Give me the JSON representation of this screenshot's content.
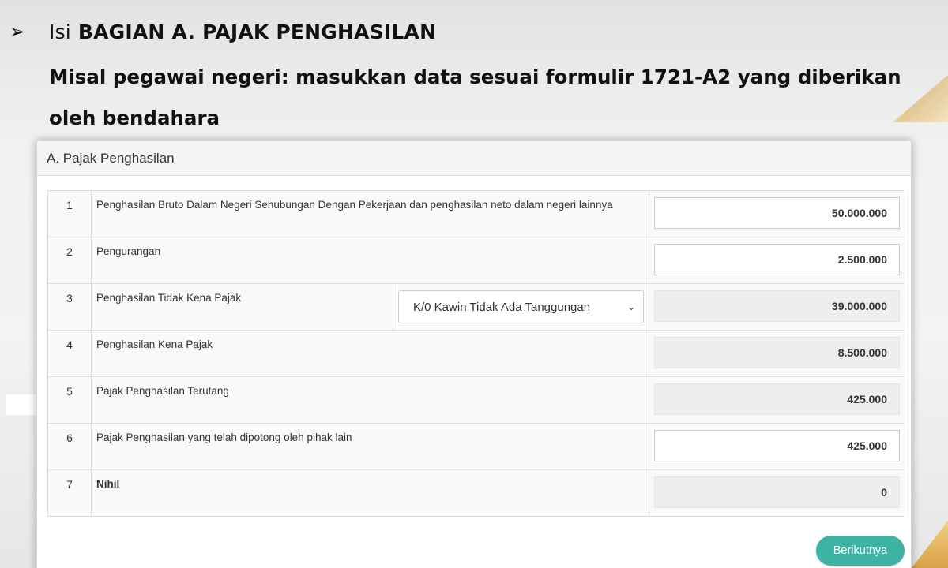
{
  "slide": {
    "bullet": "➢",
    "title_prefix": "Isi",
    "title_main": "BAGIAN A. PAJAK PENGHASILAN",
    "subtitle": "Misal pegawai negeri: masukkan data sesuai formulir 1721-A2 yang diberikan oleh bendahara"
  },
  "panel": {
    "heading": "A. Pajak Penghasilan"
  },
  "rows": [
    {
      "num": "1",
      "label": "Penghasilan Bruto Dalam Negeri Sehubungan Dengan Pekerjaan dan penghasilan neto dalam negeri lainnya",
      "value": "50.000.000"
    },
    {
      "num": "2",
      "label": "Pengurangan",
      "value": "2.500.000"
    },
    {
      "num": "3",
      "label": "Penghasilan Tidak Kena Pajak",
      "select": "K/0 Kawin Tidak Ada Tanggungan",
      "value": "39.000.000"
    },
    {
      "num": "4",
      "label": "Penghasilan Kena Pajak",
      "value": "8.500.000"
    },
    {
      "num": "5",
      "label": "Pajak Penghasilan Terutang",
      "value": "425.000"
    },
    {
      "num": "6",
      "label": "Pajak Penghasilan yang telah dipotong oleh pihak lain",
      "value": "425.000"
    },
    {
      "num": "7",
      "label": "Nihil",
      "value": "0"
    }
  ],
  "buttons": {
    "next": "Berikutnya"
  },
  "colors": {
    "accent": "#3cb3a3",
    "readonly_field": "#eeeeee",
    "gold": "#d9a14a"
  },
  "icons": {
    "select_chevron": "chevron-down-icon"
  }
}
